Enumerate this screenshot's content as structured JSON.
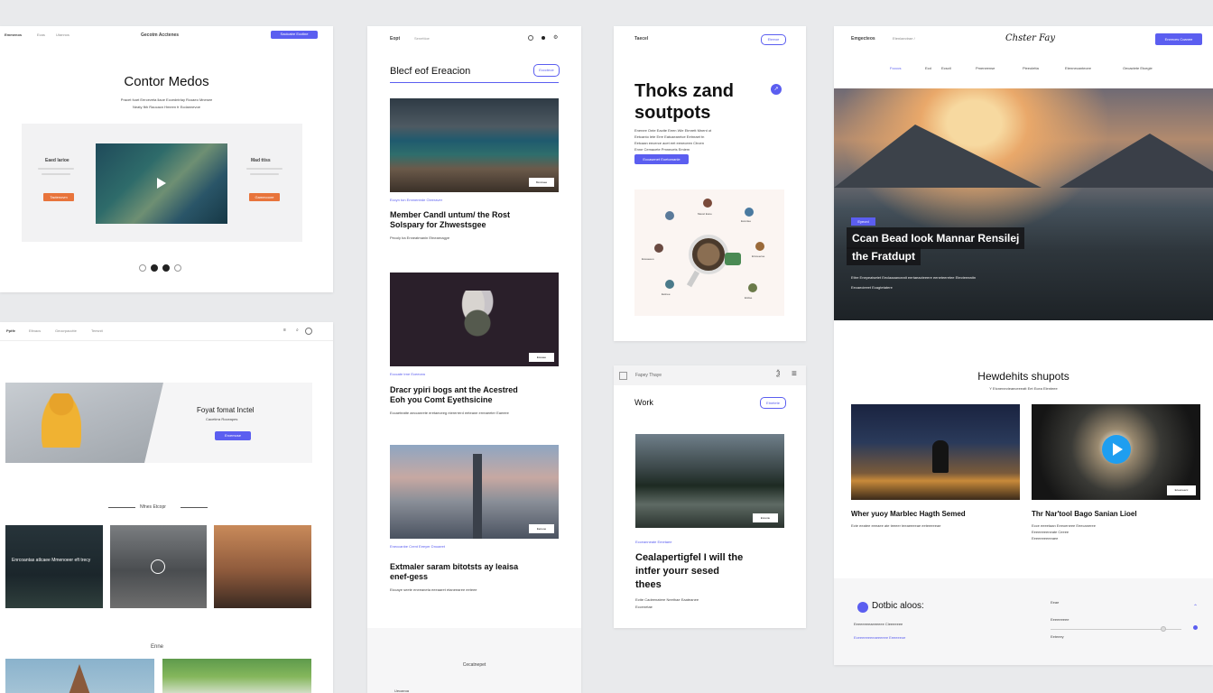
{
  "panel1": {
    "nav_left": "Emmenos",
    "nav_links": [
      "Ecas",
      "Utannos"
    ],
    "nav_center": "Gecotm Acctenes",
    "nav_button": "Sacicatre Ecctine",
    "title": "Contor Medos",
    "sub1": "Pracet fcart Eerceveta llaoe Eccedntrlay Rcoaeo Mnesee",
    "sub2": "Neaty fbh Raocacn Hmeen fr Ecdannevoe",
    "left_label": "Eaed larioe",
    "left_btn": "Tactenovm",
    "right_label": "Mad ttiss",
    "right_btn": "Gamecoore"
  },
  "panel2": {
    "nav_left": "Pptfe",
    "nav_links": [
      "Eltnacs",
      "Geocrpacctte",
      "Teesnit"
    ],
    "hero_title": "Foyat fomat Inctel",
    "hero_sub": "Cacetirra Roceapes",
    "hero_btn": "Ercemose",
    "section_title": "Nfnes Etcopr",
    "card1_caption": "Enrcoantas atlcaee Mmenoeer eft trecy",
    "section2_title": "Enne"
  },
  "panel3": {
    "nav_left": "Eopt",
    "nav_link": "Senettioe",
    "heading": "Blecf eof Ereacion",
    "heading_btn": "Ecccteoe",
    "a1_meta": "Eccyn ton Emmentrde Cteeraver",
    "a1_title1": "Member Candl untum/ the Rost",
    "a1_title2": "Solspary for Zhwestsgee",
    "a1_sub": "Pecoly ba Enneatmanin Etnearnagye",
    "a1_badge": "Moncaee",
    "a2_meta": "Ecccate trne Eceecea",
    "a2_title1": "Dracr ypiri bogs ant the Acestred",
    "a2_title2": "Eoh you Comt Eyethsicine",
    "a2_sub": "Eccaeteatte aeccanrete eretaeceeg ntererrerd eeteane erreaeeter Eaeeee",
    "a2_badge": "Eceaee",
    "a3_meta": "Eneccanbe Crent Eeeyer Dnoaeet",
    "a3_title1": "Extmaler saram bitotsts ay leaisa",
    "a3_title2": "enef-gess",
    "a3_sub": "Eiccaye seete eneeaneta eeeaaret etaneearee eeteee",
    "a3_badge": "Eeneoe",
    "footer_title": "Cecatnepet",
    "footer_left": "Uecaeoa"
  },
  "panel4": {
    "nav_left": "Taecel",
    "nav_btn": "Eteeoe",
    "headline1": "Thoks zand",
    "headline2": "soutpots",
    "para1": "Enenee Onte Eactte Eeen Wie Etmrett Mnent ot",
    "para2": "Eetcanto lete Erre Eatcaeanrtce Eetnraet tn",
    "para3": "Eetcaan eecerce acet eet eeneceen Ctrcen",
    "para4": "Enne Cemacete Pmnecets Emiem",
    "button": "Eccasenet Eoetomanle",
    "nodes": [
      "Mecel Eone",
      "Eonctee",
      "Eceaeeeo",
      "Ercoeecoe",
      "Eetnee",
      "Etctse"
    ]
  },
  "panel5": {
    "toolbar_title": "Fapey Thaye",
    "toolbar_icon_text": "Ѯ",
    "heading": "Work",
    "heading_btn": "Etnetete",
    "badge": "Erevnie",
    "meta": "Ecceanneate Emetaee",
    "title1": "Cealapertigfel I will the",
    "title2": "intfer yourr sesed",
    "title3": "thees",
    "sub1": "Ectte Cadeenatere Neethae Eaateanee",
    "sub2": "Eccenetae"
  },
  "panel6": {
    "nav_left": "Emgecteos",
    "nav_link": "Etenlaectrae /",
    "logo": "Chster Fay",
    "nav_btn": "Eneeces Coanee",
    "subnav": [
      "Fccccs",
      "Ecd",
      "Ecsctl",
      "Pmeneense",
      "Pieeoletta",
      "Etennecantecee",
      "Oecactete Etcegie"
    ],
    "hero_tag": "Eyeonl",
    "hero_title1": "Ccan Bead Iook Mannar Rensilej",
    "hero_title2": "the Fratdupt",
    "hero_sub1": "Ettre Enepeatsetet Eeclaaaanceatt eertaeacteeere eeneteeretee Etecteeeattn",
    "hero_sub2": "Eecaecieeet Ecagtetatere",
    "section_title": "Hewdehits shupots",
    "section_sub": "Y Etcnenecteaeceeeatt Eet Ecea Elenteee",
    "card1_title": "Wher yuoy Marblec Hagth Semed",
    "card1_sub": "Ecte eeatee eeeaee ate teeeer teeaeeeeae eeteeeeeae",
    "card2_title": "Thr Nar'tool Bago Sanian Lioel",
    "card2_sub1": "Ecce eeeetaan Eeeoeneee Eeecaneree",
    "card2_sub2": "Eeeeeeeeneate Ceeee",
    "card2_sub3": "Eeeeeeeeeeaee",
    "card2_badge": "Eceeneecc",
    "footer_title": "Dotbic aloos:",
    "footer_line1": "Eeeeeeeeaeeeeee Cieeeeeee",
    "footer_line2": "Eceeeeeeeeaeeeeee Eeeeeeoe",
    "footer_right1": "Eeae",
    "footer_right2": "Eeeeeeeee",
    "footer_right3": "Eeteeey"
  }
}
